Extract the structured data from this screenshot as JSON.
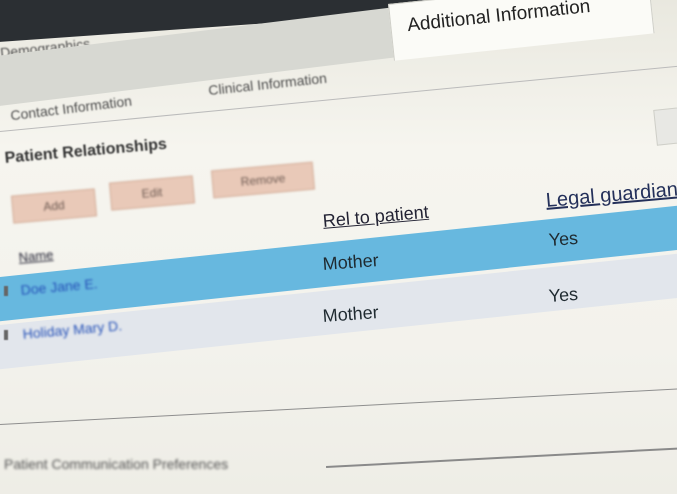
{
  "tabs": {
    "row1": {
      "demographics": "Demographics"
    },
    "row2": {
      "contact": "Contact Information",
      "clinical": "Clinical Information",
      "additional": "Additional Information"
    }
  },
  "section": {
    "title": "Patient Relationships"
  },
  "buttons": {
    "add": "Add",
    "edit": "Edit",
    "remove": "Remove"
  },
  "table": {
    "headers": {
      "name": "Name",
      "rel": "Rel to patient",
      "guardian": "Legal guardian"
    },
    "rows": [
      {
        "name": "Doe Jane E.",
        "rel": "Mother",
        "guardian": "Yes",
        "selected": true
      },
      {
        "name": "Holiday Mary D.",
        "rel": "Mother",
        "guardian": "Yes",
        "selected": false
      }
    ]
  },
  "footer": {
    "comm_prefs": "Patient Communication Preferences"
  },
  "colors": {
    "selected_row": "#67b8df",
    "alt_row": "#e2e6ec",
    "button_bg": "#e9c9b8",
    "link": "#2652b8"
  }
}
